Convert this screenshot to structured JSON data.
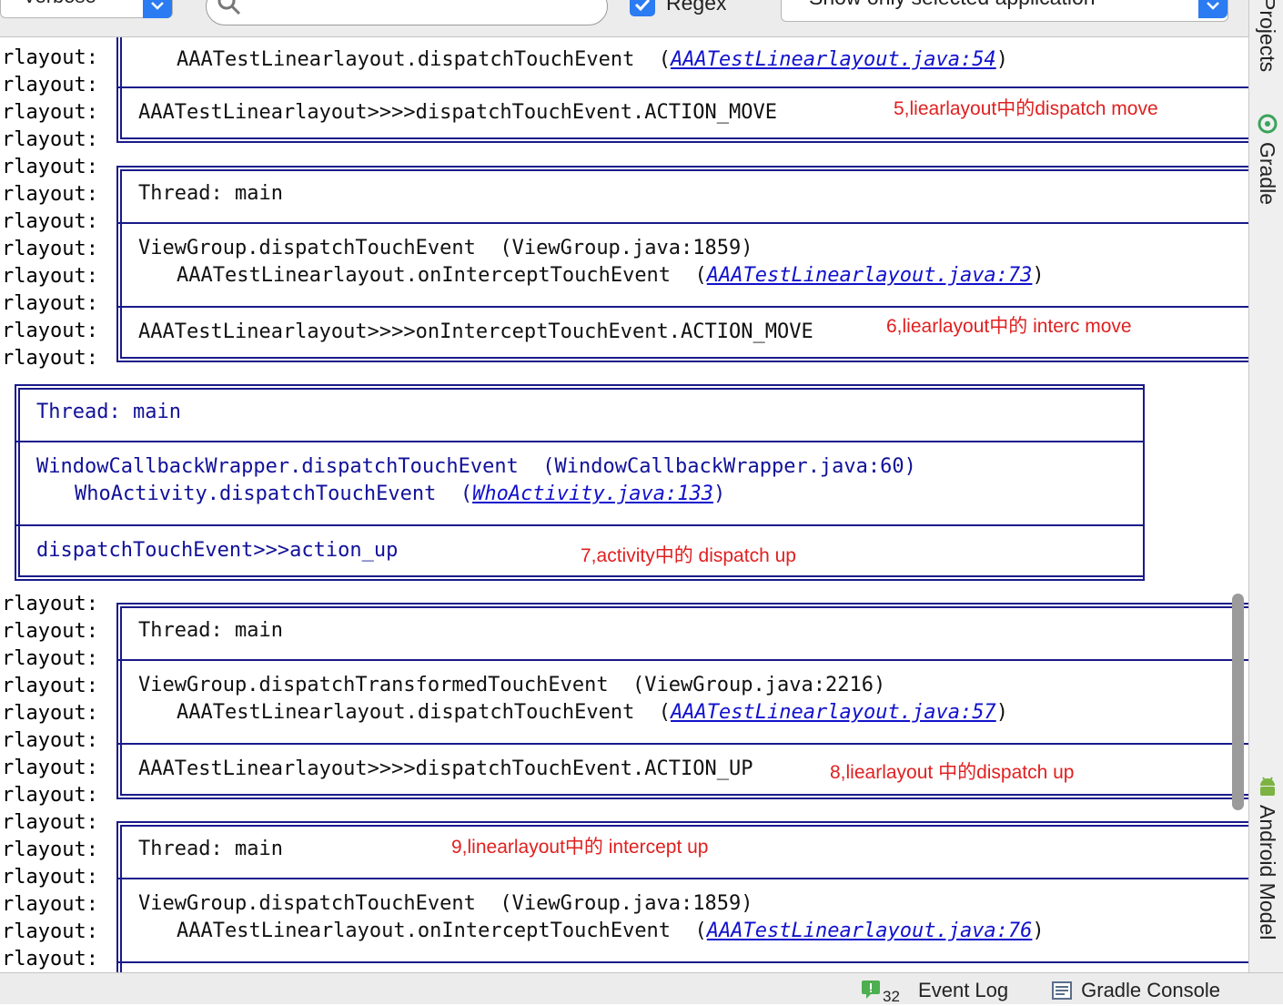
{
  "toolbar": {
    "log_level": "Verbose",
    "search_value": "",
    "regex_label": "Regex",
    "regex_checked": true,
    "app_filter": "Show only selected application"
  },
  "log": {
    "prefix": "rlayout:",
    "blocks": [
      {
        "top_line": "AAATestLinearlayout.dispatchTouchEvent  (",
        "top_link": "AAATestLinearlayout.java:54",
        "bottom_line": "AAATestLinearlayout>>>>dispatchTouchEvent.ACTION_MOVE",
        "note": "5,liearlayout中的dispatch move"
      },
      {
        "thread": "Thread: main",
        "stack_line1": "ViewGroup.dispatchTouchEvent  (ViewGroup.java:1859)",
        "stack_line2": "AAATestLinearlayout.onInterceptTouchEvent  (",
        "stack_link": "AAATestLinearlayout.java:73",
        "bottom_line": "AAATestLinearlayout>>>>onInterceptTouchEvent.ACTION_MOVE",
        "note": "6,liearlayout中的 interc move"
      },
      {
        "thread": "Thread: main",
        "stack_line1": "WindowCallbackWrapper.dispatchTouchEvent  (WindowCallbackWrapper.java:60)",
        "stack_line2": "WhoActivity.dispatchTouchEvent  (",
        "stack_link": "WhoActivity.java:133",
        "bottom_line": "dispatchTouchEvent>>>action_up",
        "note": "7,activity中的 dispatch up"
      },
      {
        "thread": "Thread: main",
        "stack_line1": "ViewGroup.dispatchTransformedTouchEvent  (ViewGroup.java:2216)",
        "stack_line2": "AAATestLinearlayout.dispatchTouchEvent  (",
        "stack_link": "AAATestLinearlayout.java:57",
        "bottom_line": "AAATestLinearlayout>>>>dispatchTouchEvent.ACTION_UP",
        "note": "8,liearlayout 中的dispatch up"
      },
      {
        "thread": "Thread: main",
        "stack_line1": "ViewGroup.dispatchTouchEvent  (ViewGroup.java:1859)",
        "stack_line2": "AAATestLinearlayout.onInterceptTouchEvent  (",
        "stack_link": "AAATestLinearlayout.java:76",
        "note": "9,linearlayout中的 intercept up"
      }
    ],
    "close_paren": ")"
  },
  "side_tabs": {
    "projects": "Projects",
    "gradle": "Gradle",
    "android_model": "Android Model"
  },
  "bottom_bar": {
    "event_count": "32",
    "event_log": "Event Log",
    "gradle_console": "Gradle Console"
  },
  "colors": {
    "accent": "#2b7bf2",
    "frame": "#1a1a8a",
    "annotation": "#e02020",
    "link": "#1111cc"
  }
}
